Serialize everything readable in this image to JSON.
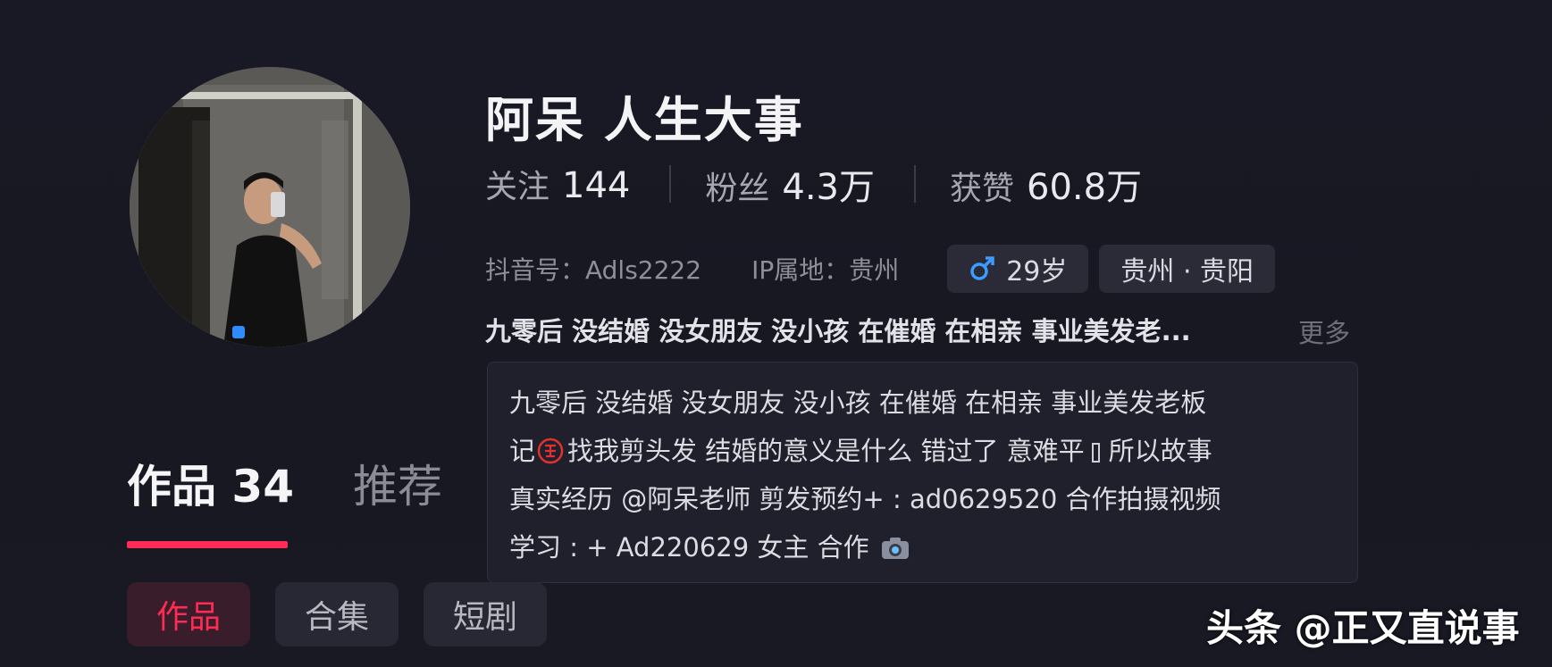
{
  "profile": {
    "name": "阿呆 人生大事",
    "stats": {
      "following_label": "关注",
      "following_value": "144",
      "fans_label": "粉丝",
      "fans_value": "4.3万",
      "likes_label": "获赞",
      "likes_value": "60.8万"
    },
    "meta": {
      "douyin_id": "抖音号：Adls2222",
      "ip_location": "IP属地：贵州",
      "age_chip": "29岁",
      "location_chip": "贵州 · 贵阳"
    },
    "bio_preview": "九零后 没结婚 没女朋友 没小孩 在催婚 在相亲 事业美发老...",
    "more_label": "更多",
    "bio_full": {
      "line1": "九零后 没结婚 没女朋友 没小孩 在催婚 在相亲 事业美发老板",
      "line2_a": "记",
      "line2_b": "找我剪头发 结婚的意义是什么 错过了 意难平",
      "line2_c": "所以故事",
      "line3": "真实经历 @阿呆老师 剪发预约+ : ad0629520 合作拍摄视频",
      "line4": "学习 : + Ad220629 女主 合作"
    }
  },
  "tabs": {
    "works_label": "作品 34",
    "recommend_label": "推荐"
  },
  "subtabs": {
    "works": "作品",
    "collections": "合集",
    "short_drama": "短剧"
  },
  "watermark": "头条 @正又直说事",
  "colors": {
    "accent": "#fe2c55",
    "background": "#171822",
    "male_icon": "#3d9bff"
  },
  "icons": {
    "age_chip_icon": "male-symbol-icon",
    "bio_seal_icon": "red-seal-icon",
    "bio_end_icon": "camera-icon"
  }
}
